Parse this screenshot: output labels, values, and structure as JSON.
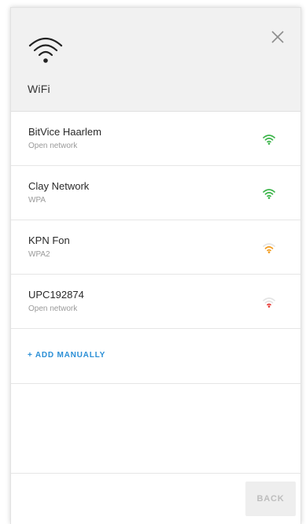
{
  "header": {
    "icon": "wifi-icon",
    "title": "WiFi",
    "close_icon": "close-icon"
  },
  "networks": [
    {
      "name": "BitVice Haarlem",
      "security": "Open network",
      "signal_color": "#3cb54a",
      "signal_icon": "wifi-signal-icon"
    },
    {
      "name": "Clay Network",
      "security": "WPA",
      "signal_color": "#3cb54a",
      "signal_icon": "wifi-signal-icon"
    },
    {
      "name": "KPN Fon",
      "security": "WPA2",
      "signal_color": "#f29b1d",
      "signal_icon": "wifi-signal-icon"
    },
    {
      "name": "UPC192874",
      "security": "Open network",
      "signal_color": "#e53935",
      "signal_icon": "wifi-signal-icon"
    }
  ],
  "actions": {
    "add_manually": "+ ADD MANUALLY",
    "back": "BACK"
  },
  "colors": {
    "accent": "#2b8fd6",
    "header_bg": "#f1f1f1",
    "signal_strong": "#3cb54a",
    "signal_medium": "#f29b1d",
    "signal_weak": "#e53935",
    "signal_inactive": "#e4e4e4"
  }
}
